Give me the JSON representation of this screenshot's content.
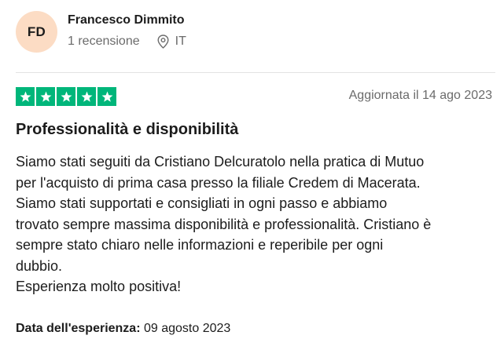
{
  "reviewer": {
    "initials": "FD",
    "name": "Francesco Dimmito",
    "review_count": "1 recensione",
    "country": "IT",
    "avatar_color": "#fcdcc4"
  },
  "review": {
    "rating": 5,
    "rating_max": 5,
    "star_color": "#00b67a",
    "date": "Aggiornata il 14 ago 2023",
    "title": "Professionalità e disponibilità",
    "body_lines": [
      "Siamo stati seguiti da Cristiano Delcuratolo nella pratica di Mutuo",
      "per l'acquisto di prima casa presso la filiale Credem di Macerata.",
      "Siamo stati supportati e consigliati in ogni passo e abbiamo",
      "trovato sempre massima disponibilità e professionalità. Cristiano è",
      "sempre stato chiaro nelle informazioni e reperibile per ogni",
      "dubbio.",
      "Esperienza molto positiva!"
    ],
    "experience_label": "Data dell'esperienza:",
    "experience_date": "09 agosto 2023"
  },
  "icons": {
    "location": "location-pin-icon",
    "star": "star-icon"
  }
}
